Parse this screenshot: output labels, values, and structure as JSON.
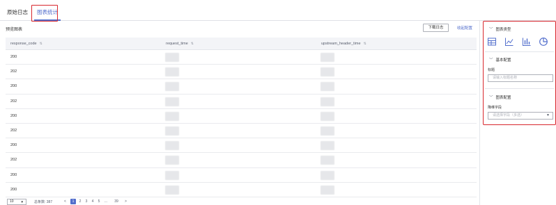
{
  "tabs": [
    {
      "label": "原始日志"
    },
    {
      "label": "图表统计"
    }
  ],
  "toolbar": {
    "preview_label": "预览图表",
    "download_label": "下载日志",
    "collapse_label": "收起配置"
  },
  "table": {
    "columns": [
      {
        "label": "response_code"
      },
      {
        "label": "request_time"
      },
      {
        "label": "upstream_header_time"
      }
    ],
    "rows": [
      {
        "response_code": "200"
      },
      {
        "response_code": "202"
      },
      {
        "response_code": "200"
      },
      {
        "response_code": "202"
      },
      {
        "response_code": "200"
      },
      {
        "response_code": "202"
      },
      {
        "response_code": "200"
      },
      {
        "response_code": "202"
      },
      {
        "response_code": "200"
      },
      {
        "response_code": "200"
      }
    ]
  },
  "pager": {
    "page_size": "10",
    "total_label": "总条数: 387",
    "prev": "<",
    "pages": [
      "1",
      "2",
      "3",
      "4",
      "5",
      "...",
      "39"
    ],
    "next": ">"
  },
  "side": {
    "chart_type_title": "图表类型",
    "chart_types": [
      "table-icon",
      "line-chart-icon",
      "bar-chart-icon",
      "pie-chart-icon"
    ],
    "basic_title": "基本配置",
    "title_label": "标题",
    "title_placeholder": "请输入标题名称",
    "chart_config_title": "图表配置",
    "dim_label": "降维字段",
    "dim_placeholder": "请选择字段（多选）"
  },
  "colors": {
    "accent": "#526ecc",
    "highlight": "#d8262c"
  }
}
